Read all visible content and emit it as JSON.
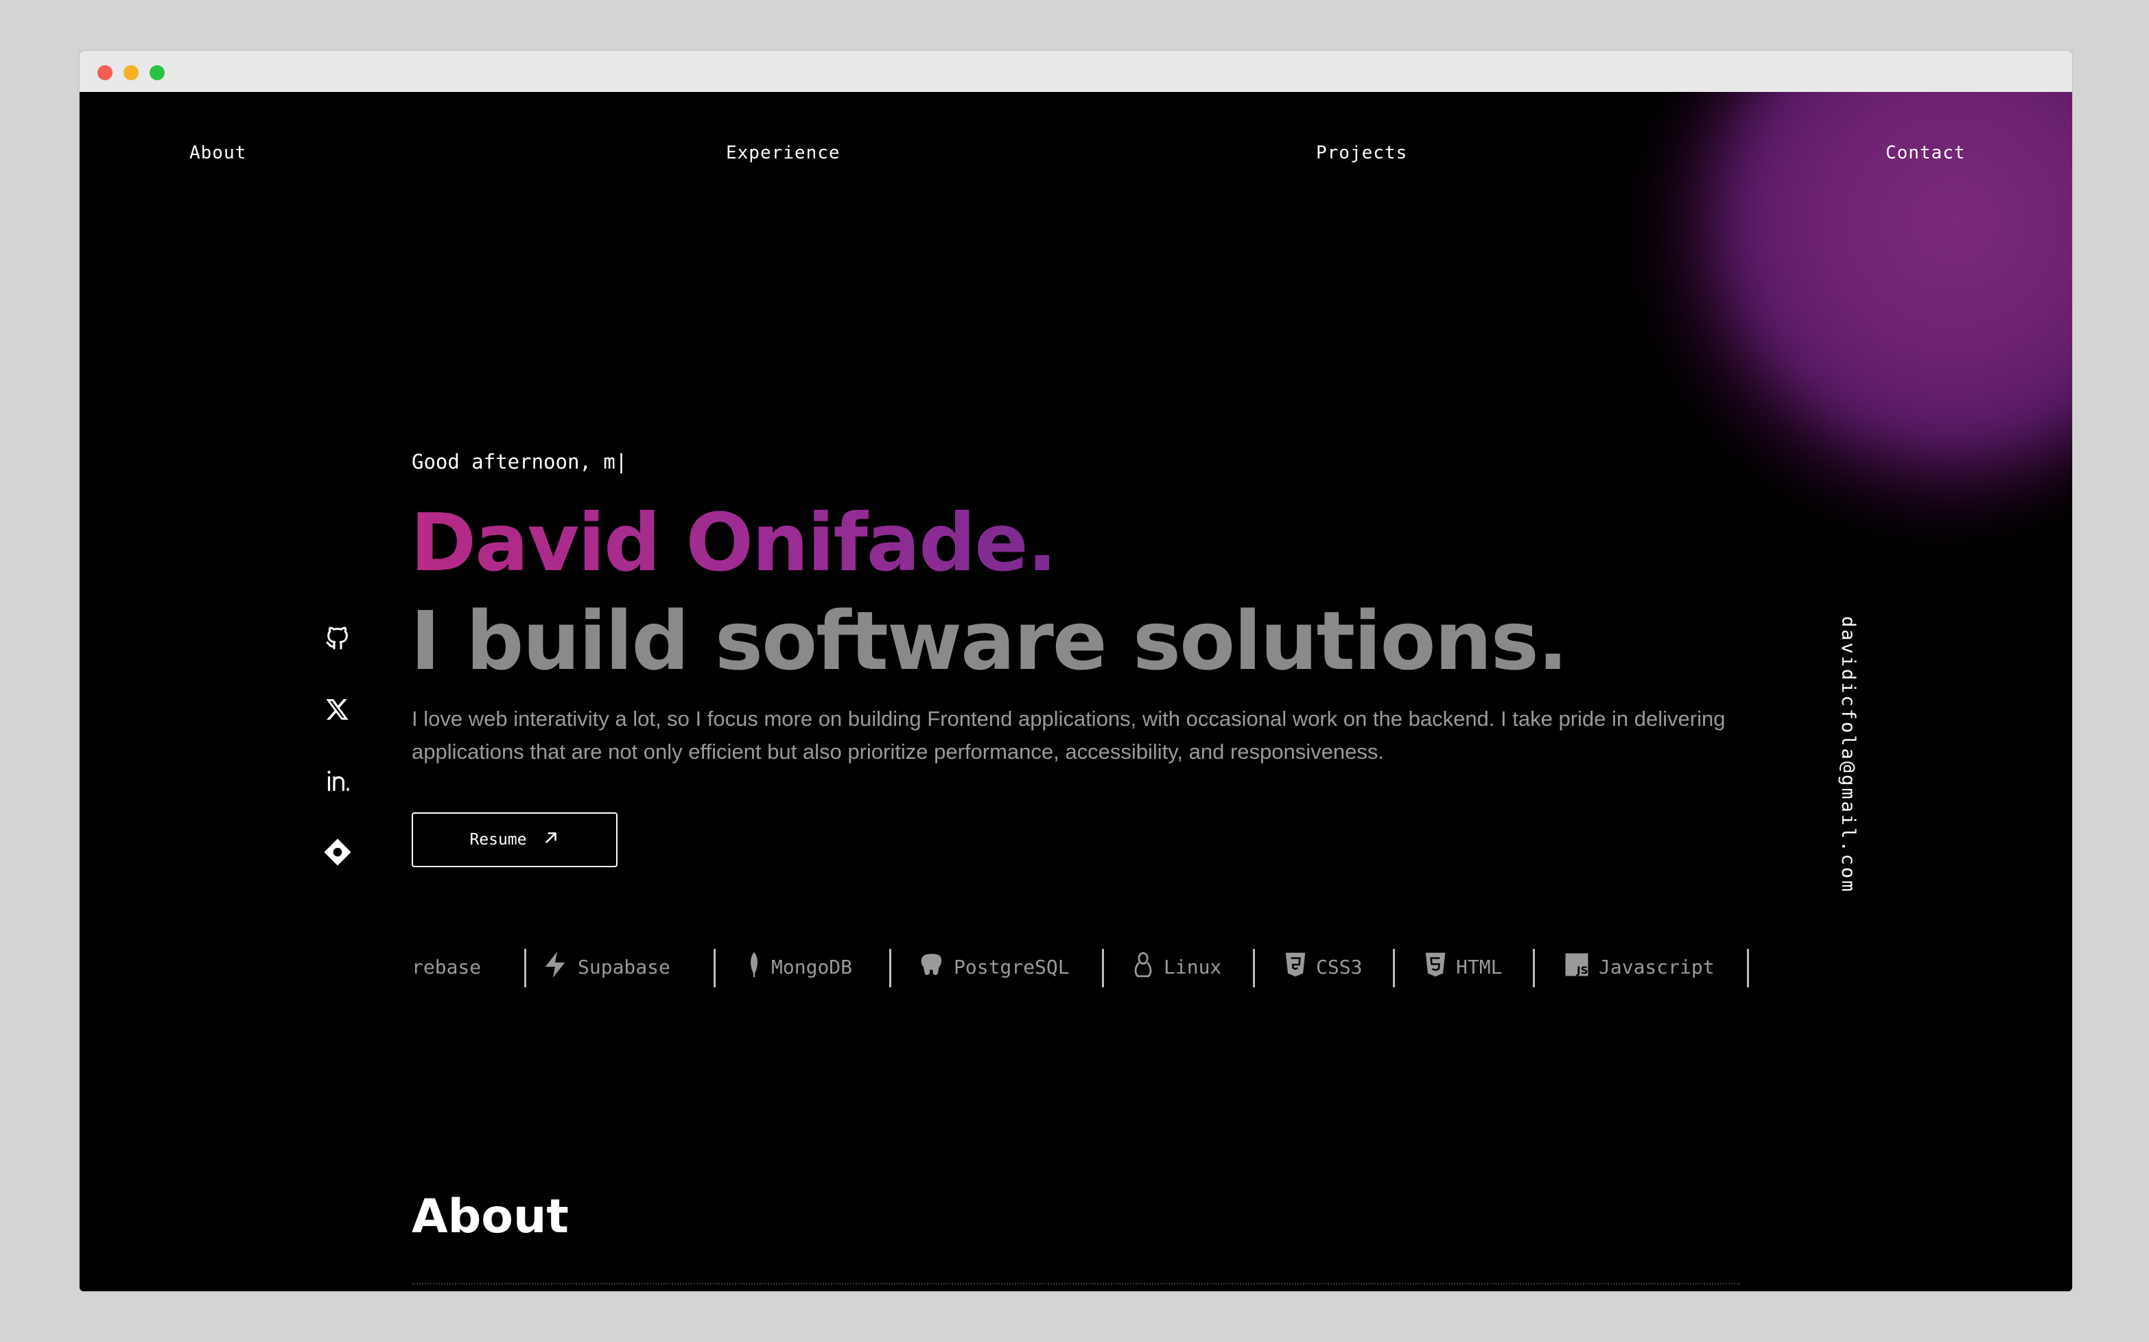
{
  "nav": {
    "about": "About",
    "experience": "Experience",
    "projects": "Projects",
    "contact": "Contact"
  },
  "hero": {
    "greeting": "Good afternoon, m|",
    "name": "David Onifade.",
    "tagline": "I build software solutions.",
    "bio": "I love web interativity a lot, so I focus more on building Frontend applications, with occasional work on the backend. I take pride in delivering applications that are not only efficient but also prioritize performance, accessibility, and responsiveness.",
    "resume_label": "Resume"
  },
  "socials": [
    "github-icon",
    "x-icon",
    "linkedin-icon",
    "hashnode-icon"
  ],
  "email": "davidicfola@gmail.com",
  "tech": {
    "items": [
      "rebase",
      "Supabase",
      "MongoDB",
      "PostgreSQL",
      "Linux",
      "CSS3",
      "HTML",
      "Javascript"
    ]
  },
  "sections": {
    "about_title": "About"
  },
  "colors": {
    "background": "#000000",
    "name_gradient_start": "#b62b86",
    "name_gradient_end": "#7c2b92",
    "tagline": "#8a8a8a",
    "glow": "#7a2a7a"
  }
}
